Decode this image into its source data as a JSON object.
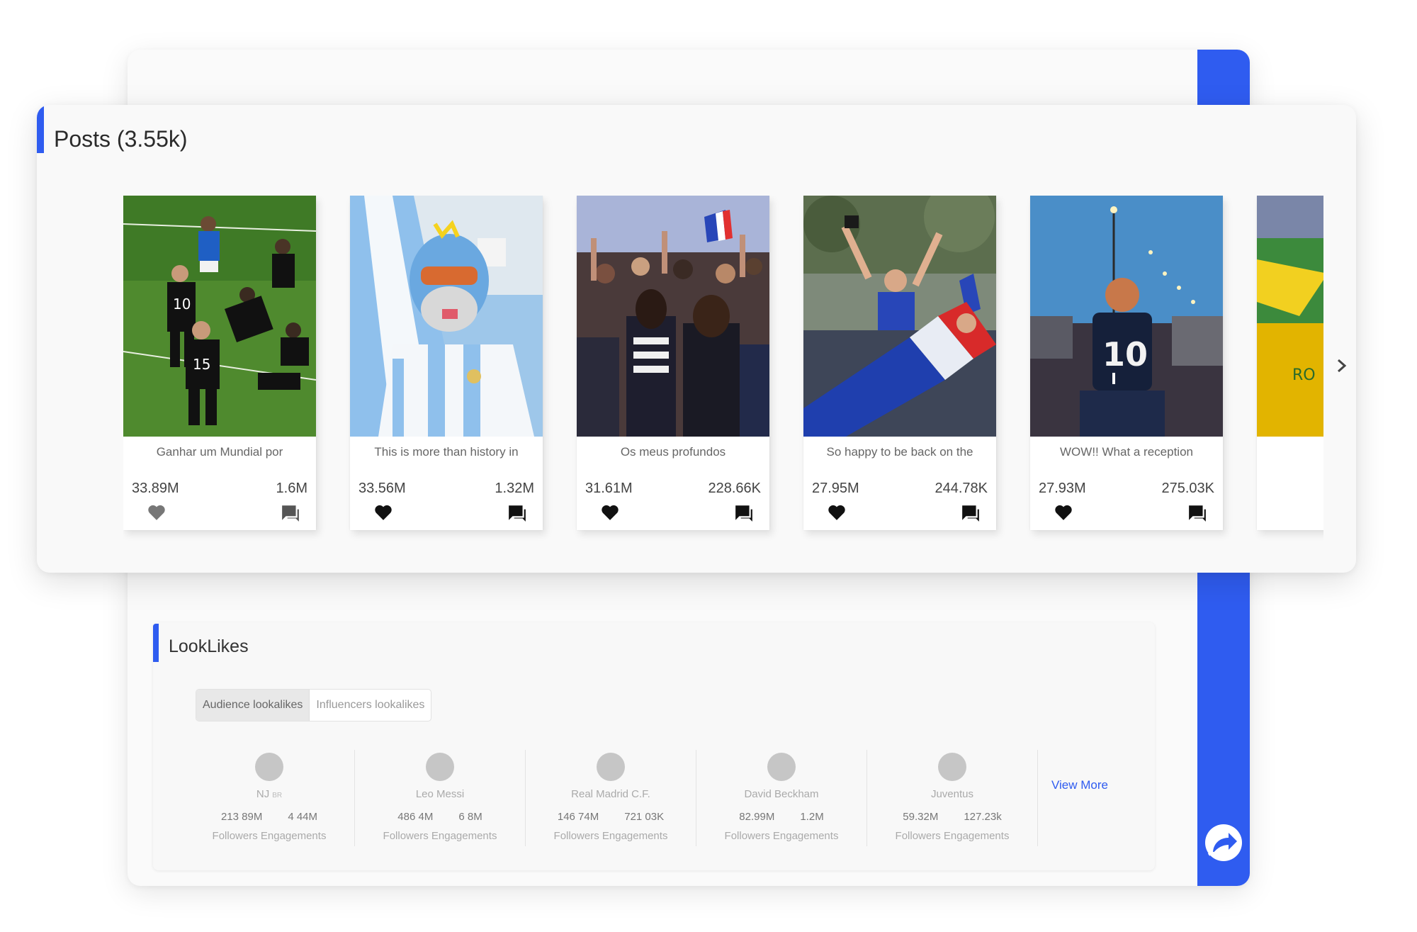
{
  "posts": {
    "title": "Posts (3.55k)",
    "items": [
      {
        "caption": "Ganhar um Mundial por",
        "likes": "33.89M",
        "comments": "1.6M",
        "image": "rugby-match-photo"
      },
      {
        "caption": "This is more than history in",
        "likes": "33.56M",
        "comments": "1.32M",
        "image": "argentina-fan-photo"
      },
      {
        "caption": "Os meus profundos",
        "likes": "31.61M",
        "comments": "228.66K",
        "image": "crowd-celebration-photo"
      },
      {
        "caption": "So happy to be back on the",
        "likes": "27.95M",
        "comments": "244.78K",
        "image": "france-fan-celebration-photo"
      },
      {
        "caption": "WOW!! What a reception",
        "likes": "27.93M",
        "comments": "275.03K",
        "image": "child-france-jersey-photo"
      },
      {
        "caption": "",
        "likes": "",
        "comments": "",
        "image": "stadium-fans-partial-photo"
      }
    ],
    "next_icon": "chevron-right-icon"
  },
  "looklikes": {
    "title": "LookLikes",
    "tabs": [
      "Audience lookalikes",
      "Influencers lookalikes"
    ],
    "active_tab": "Audience lookalikes",
    "items": [
      {
        "name": "NJ",
        "tag": "BR",
        "followers": "213 89M",
        "engagements": "4 44M",
        "labels": "Followers Engagements"
      },
      {
        "name": "Leo Messi",
        "tag": "",
        "followers": "486 4M",
        "engagements": "6 8M",
        "labels": "Followers Engagements"
      },
      {
        "name": "Real Madrid C.F.",
        "tag": "",
        "followers": "146 74M",
        "engagements": "721 03K",
        "labels": "Followers Engagements"
      },
      {
        "name": "David Beckham",
        "tag": "",
        "followers": "82.99M",
        "engagements": "1.2M",
        "labels": "Followers Engagements"
      },
      {
        "name": "Juventus",
        "tag": "",
        "followers": "59.32M",
        "engagements": "127.23k",
        "labels": "Followers Engagements"
      }
    ],
    "view_more": "View More"
  },
  "colors": {
    "accent": "#2f5cf0",
    "link": "#2f5cf0"
  }
}
